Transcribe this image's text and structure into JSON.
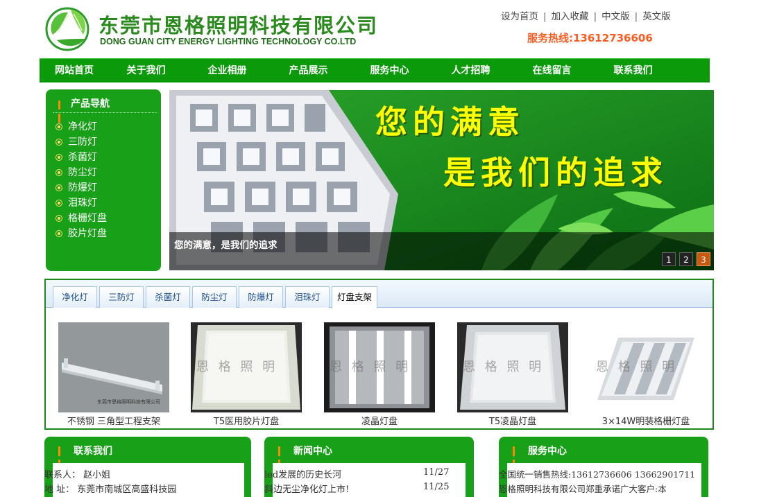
{
  "header": {
    "company_cn": "东莞市恩格照明科技有限公司",
    "company_en": "DONG GUAN CITY ENERGY LIGHTING TECHNOLOGY CO.LTD",
    "top_links": [
      "设为首页",
      "加入收藏",
      "中文版",
      "英文版"
    ],
    "hotline": "服务热线:13612736606"
  },
  "nav": {
    "items": [
      "网站首页",
      "关于我们",
      "企业相册",
      "产品展示",
      "服务中心",
      "人才招聘",
      "在线留言",
      "联系我们"
    ]
  },
  "product_nav": {
    "title": "产品导航",
    "items": [
      "净化灯",
      "三防灯",
      "杀菌灯",
      "防尘灯",
      "防爆灯",
      "泪珠灯",
      "格栅灯盘",
      "胶片灯盘"
    ]
  },
  "banner": {
    "slogan_line1": "您的满意",
    "slogan_line2": "是我们的追求",
    "caption": "您的满意，是我们的追求",
    "pages": [
      "1",
      "2",
      "3"
    ],
    "active_page": 3
  },
  "product_tabs": {
    "tabs": [
      "净化灯",
      "三防灯",
      "杀菌灯",
      "防尘灯",
      "防爆灯",
      "泪珠灯",
      "灯盘支架"
    ],
    "active": "灯盘支架",
    "watermark": "恩 格 照 明",
    "products": [
      {
        "caption": "不锈钢 三角型工程支架",
        "photo_label": "东莞市恩格照明科技有限公司"
      },
      {
        "caption": "T5医用胶片灯盘"
      },
      {
        "caption": "凌晶灯盘"
      },
      {
        "caption": "T5凌晶灯盘"
      },
      {
        "caption": "3×14W明装格栅灯盘"
      }
    ]
  },
  "contact": {
    "title": "联系我们",
    "lines": [
      "联系人： 赵小姐",
      "地 址： 东莞市南城区高盛科技园"
    ]
  },
  "news": {
    "title": "新闻中心",
    "items": [
      {
        "title": "led发展的历史长河",
        "date": "11/27"
      },
      {
        "title": "斜边无尘净化灯上市!",
        "date": "11/25"
      }
    ]
  },
  "service": {
    "title": "服务中心",
    "lines": [
      "全国统一销售热线:13612736606 13662901711",
      "恩格照明科技有限公司郑重承诺广大客户:本"
    ]
  },
  "colors": {
    "brand_green": "#18a018",
    "nav_green": "#0a9a0a",
    "hotline_orange": "#ff5a1f",
    "slogan_yellow": "#ffff00"
  }
}
